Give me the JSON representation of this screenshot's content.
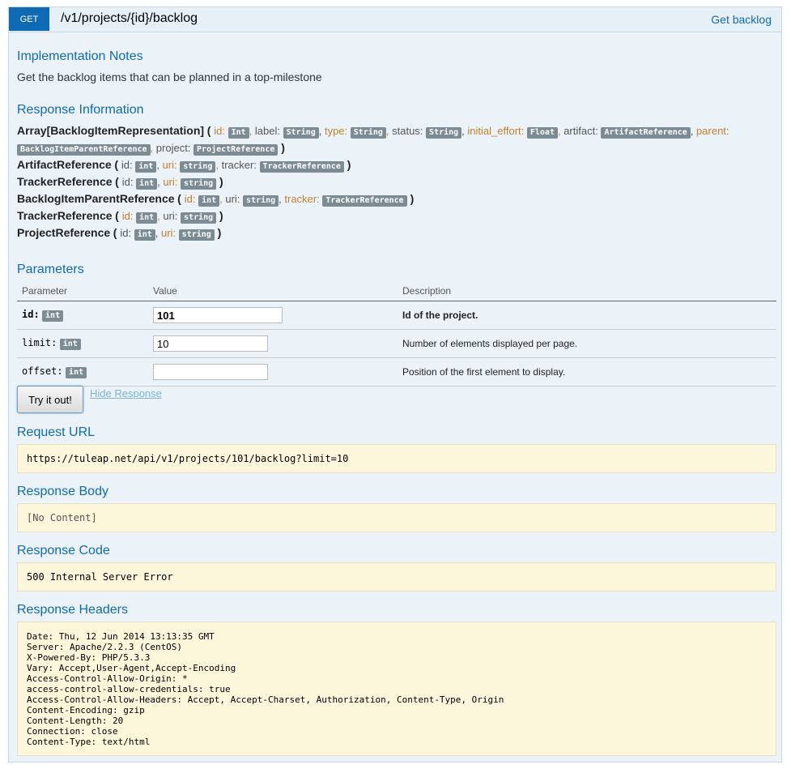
{
  "operation": {
    "method": "GET",
    "path": "/v1/projects/{id}/backlog",
    "summary": "Get backlog"
  },
  "implementation": {
    "heading": "Implementation Notes",
    "text": "Get the backlog items that can be planned in a top-milestone"
  },
  "response_info": {
    "heading": "Response Information",
    "models": [
      {
        "name": "Array[BacklogItemRepresentation]",
        "props": [
          {
            "name": "id:",
            "type": "Int",
            "optional": true
          },
          {
            "name": "label:",
            "type": "String",
            "optional": false
          },
          {
            "name": "type:",
            "type": "String",
            "optional": true
          },
          {
            "name": "status:",
            "type": "String",
            "optional": false
          },
          {
            "name": "initial_effort:",
            "type": "Float",
            "optional": true
          },
          {
            "name": "artifact:",
            "type": "ArtifactReference",
            "optional": false
          },
          {
            "name": "parent:",
            "type": "BacklogItemParentReference",
            "optional": true
          },
          {
            "name": "project:",
            "type": "ProjectReference",
            "optional": false
          }
        ]
      },
      {
        "name": "ArtifactReference",
        "props": [
          {
            "name": "id:",
            "type": "int",
            "optional": false
          },
          {
            "name": "uri:",
            "type": "string",
            "optional": true
          },
          {
            "name": "tracker:",
            "type": "TrackerReference",
            "optional": false
          }
        ]
      },
      {
        "name": "TrackerReference",
        "props": [
          {
            "name": "id:",
            "type": "int",
            "optional": false
          },
          {
            "name": "uri:",
            "type": "string",
            "optional": true
          }
        ]
      },
      {
        "name": "BacklogItemParentReference",
        "props": [
          {
            "name": "id:",
            "type": "int",
            "optional": true
          },
          {
            "name": "uri:",
            "type": "string",
            "optional": false
          },
          {
            "name": "tracker:",
            "type": "TrackerReference",
            "optional": true
          }
        ]
      },
      {
        "name": "TrackerReference",
        "props": [
          {
            "name": "id:",
            "type": "int",
            "optional": true
          },
          {
            "name": "uri:",
            "type": "string",
            "optional": false
          }
        ]
      },
      {
        "name": "ProjectReference",
        "props": [
          {
            "name": "id:",
            "type": "int",
            "optional": false
          },
          {
            "name": "uri:",
            "type": "string",
            "optional": true
          }
        ]
      }
    ]
  },
  "parameters": {
    "heading": "Parameters",
    "columns": [
      "Parameter",
      "Value",
      "Description"
    ],
    "rows": [
      {
        "name": "id:",
        "type": "int",
        "value": "101",
        "description": "Id of the project."
      },
      {
        "name": "limit:",
        "type": "int",
        "value": "10",
        "description": "Number of elements displayed per page."
      },
      {
        "name": "offset:",
        "type": "int",
        "value": "",
        "description": "Position of the first element to display."
      }
    ],
    "try_label": "Try it out!",
    "hide_label": "Hide Response"
  },
  "request_url": {
    "heading": "Request URL",
    "value": "https://tuleap.net/api/v1/projects/101/backlog?limit=10"
  },
  "response_body": {
    "heading": "Response Body",
    "value": "[No Content]"
  },
  "response_code": {
    "heading": "Response Code",
    "value": "500 Internal Server Error"
  },
  "response_headers": {
    "heading": "Response Headers",
    "lines": [
      "Date: Thu, 12 Jun 2014 13:13:35 GMT",
      "Server: Apache/2.2.3 (CentOS)",
      "X-Powered-By: PHP/5.3.3",
      "Vary: Accept,User-Agent,Accept-Encoding",
      "Access-Control-Allow-Origin: *",
      "access-control-allow-credentials: true",
      "Access-Control-Allow-Headers: Accept, Accept-Charset, Authorization, Content-Type, Origin",
      "Content-Encoding: gzip",
      "Content-Length: 20",
      "Connection: close",
      "Content-Type: text/html"
    ]
  },
  "colors": {
    "accent": "#0f6ab4",
    "panel_bg": "#ebf3f9",
    "block_bg": "#fcf6db",
    "optional_prop": "#c0802c"
  }
}
